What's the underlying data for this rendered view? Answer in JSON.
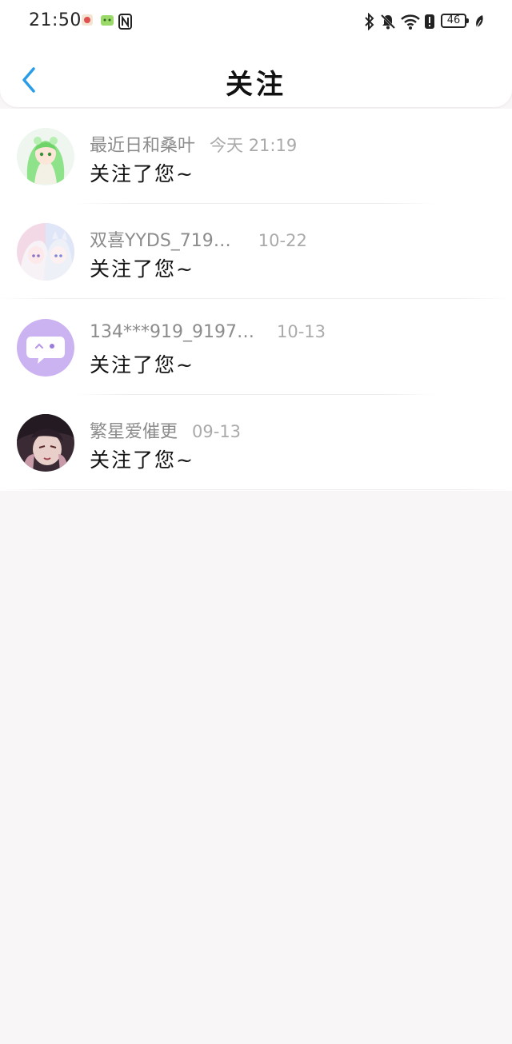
{
  "status_bar": {
    "time": "21:50",
    "battery": "46",
    "icons": [
      "record-icon",
      "app-icon",
      "nfc-icon",
      "bluetooth-icon",
      "mute-bell-icon",
      "wifi-icon",
      "alert-icon",
      "battery-icon",
      "leaf-icon"
    ]
  },
  "header": {
    "title": "关注",
    "back_icon": "chevron-left-icon"
  },
  "colors": {
    "accent": "#2a9ce8",
    "list_bg": "#ffffff",
    "page_bg": "#f8f6f7"
  },
  "notifications": [
    {
      "name": "最近日和桑叶",
      "date": "今天 21:19",
      "message": "关注了您~"
    },
    {
      "name": "双喜YYDS_719…",
      "date": "10-22",
      "message": "关注了您~"
    },
    {
      "name": "134***919_9197…",
      "date": "10-13",
      "message": "关注了您~"
    },
    {
      "name": "繁星爱催更",
      "date": "09-13",
      "message": "关注了您~"
    }
  ]
}
